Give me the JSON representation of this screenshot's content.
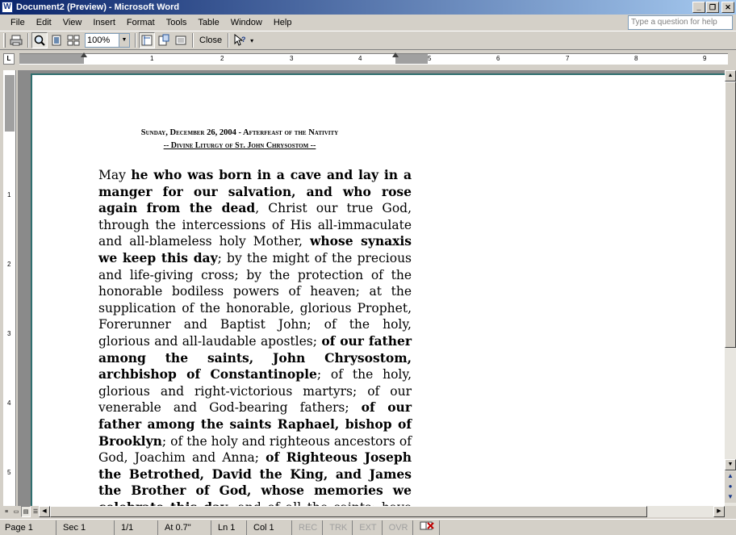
{
  "window": {
    "title": "Document2 (Preview) - Microsoft Word",
    "app_icon": "W"
  },
  "menu": {
    "items": [
      "File",
      "Edit",
      "View",
      "Insert",
      "Format",
      "Tools",
      "Table",
      "Window",
      "Help"
    ],
    "help_placeholder": "Type a question for help"
  },
  "toolbar": {
    "zoom": "100%",
    "close_label": "Close"
  },
  "ruler": {
    "corner": "L",
    "numbers": [
      "1",
      "2",
      "3",
      "4",
      "5",
      "6",
      "7",
      "8",
      "9"
    ],
    "vnumbers": [
      "1",
      "2",
      "3",
      "4",
      "5"
    ]
  },
  "document": {
    "heading_line1": "Sunday, December 26, 2004 - Afterfeast of the Nativity",
    "heading_line2": "-- Divine Liturgy of St. John Chrysostom --",
    "body": [
      {
        "t": "May ",
        "b": false
      },
      {
        "t": "he who was born in a cave and lay in a manger for our salvation, and who rose again from the dead",
        "b": true
      },
      {
        "t": ", Christ our true God, through the intercessions of His all-immaculate and all-blameless holy Mother, ",
        "b": false
      },
      {
        "t": "whose synaxis we keep this day",
        "b": true
      },
      {
        "t": "; by the might of the precious and life-giving cross; by the protection of the honorable bodiless powers of heaven; at the supplication of the honorable, glorious Prophet, Forerunner and Baptist John; of the holy, glorious and all-laudable apostles; ",
        "b": false
      },
      {
        "t": "of our father among the saints, John Chrysostom, archbishop of Constantinople",
        "b": true
      },
      {
        "t": "; of the holy, glorious and right-victorious martyrs; of our venerable and God-bearing fathers; ",
        "b": false
      },
      {
        "t": "of our father among the saints Raphael, bishop of Brooklyn",
        "b": true
      },
      {
        "t": "; of the holy and righteous ancestors of God, Joachim and Anna; ",
        "b": false
      },
      {
        "t": "of Righteous Joseph the Betrothed, David the King, and James the Brother of God, whose memories we celebrate this day",
        "b": true
      },
      {
        "t": ", and of all the saints: have mercy on us, and save us, forasmuch as He is good and loveth mankind.",
        "b": false
      }
    ]
  },
  "status": {
    "page": "Page 1",
    "sec": "Sec 1",
    "pages": "1/1",
    "at": "At 0.7\"",
    "ln": "Ln 1",
    "col": "Col 1",
    "rec": "REC",
    "trk": "TRK",
    "ext": "EXT",
    "ovr": "OVR"
  }
}
